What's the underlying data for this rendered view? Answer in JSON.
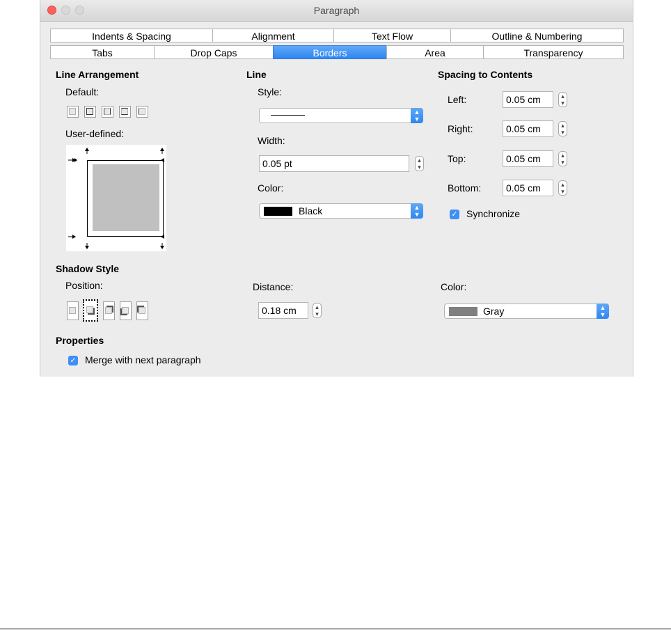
{
  "window": {
    "title": "Paragraph"
  },
  "tabs": {
    "row1": [
      "Indents & Spacing",
      "Alignment",
      "Text Flow",
      "Outline & Numbering"
    ],
    "row2": [
      "Tabs",
      "Drop Caps",
      "Borders",
      "Area",
      "Transparency"
    ],
    "selected": "Borders"
  },
  "line_arrangement": {
    "heading": "Line Arrangement",
    "default_label": "Default:",
    "user_defined_label": "User-defined:"
  },
  "line": {
    "heading": "Line",
    "style_label": "Style:",
    "width_label": "Width:",
    "width_value": "0.05 pt",
    "color_label": "Color:",
    "color_value": "Black",
    "color_swatch": "#000000"
  },
  "spacing": {
    "heading": "Spacing to Contents",
    "left_label": "Left:",
    "left_value": "0.05 cm",
    "right_label": "Right:",
    "right_value": "0.05 cm",
    "top_label": "Top:",
    "top_value": "0.05 cm",
    "bottom_label": "Bottom:",
    "bottom_value": "0.05 cm",
    "synchronize_label": "Synchronize",
    "synchronize_checked": true
  },
  "shadow": {
    "heading": "Shadow Style",
    "position_label": "Position:",
    "distance_label": "Distance:",
    "distance_value": "0.18 cm",
    "color_label": "Color:",
    "color_value": "Gray",
    "color_swatch": "#808080"
  },
  "properties": {
    "heading": "Properties",
    "merge_label": "Merge with next paragraph",
    "merge_checked": true
  },
  "colors": {
    "accent": "#3f8ff5",
    "panel": "#ececec"
  }
}
